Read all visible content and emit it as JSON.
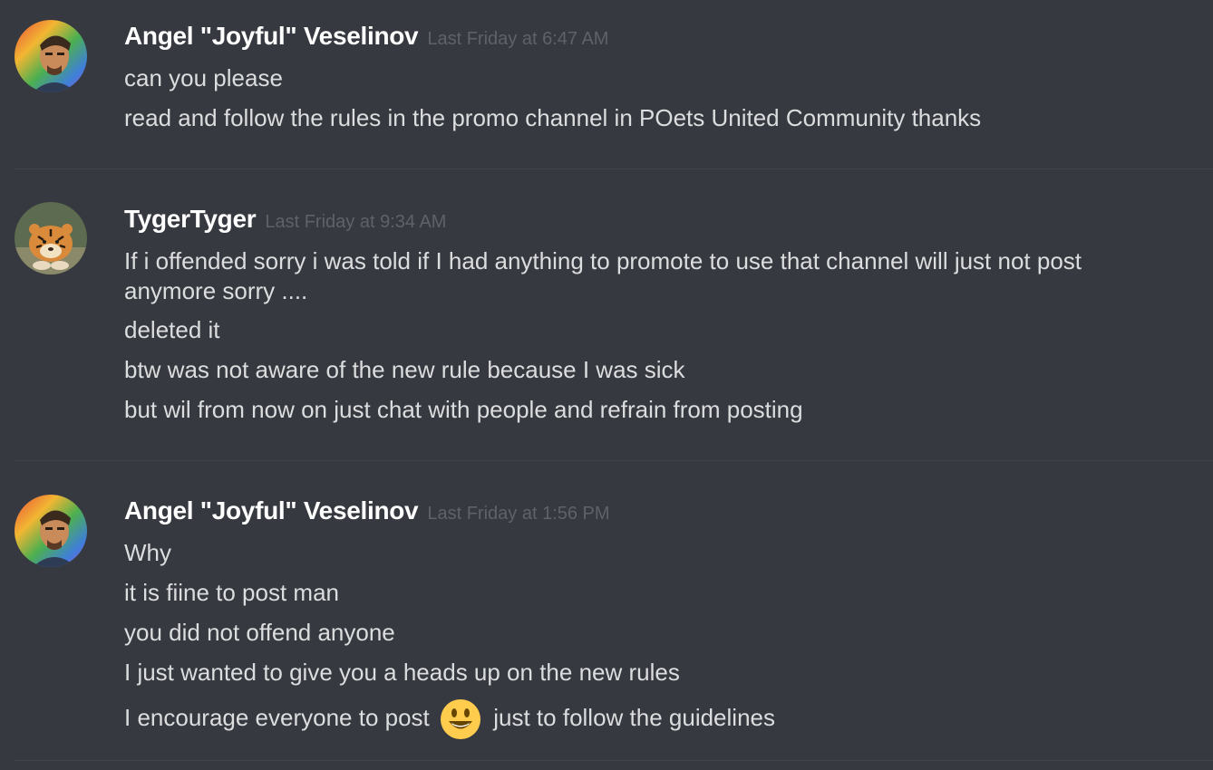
{
  "messages": [
    {
      "author": "Angel \"Joyful\" Veselinov",
      "timestamp": "Last Friday at 6:47 AM",
      "avatar": "rainbow-portrait-avatar",
      "lines": [
        "can you please",
        "read and follow the rules in the promo channel in POets United Community thanks"
      ]
    },
    {
      "author": "TygerTyger",
      "timestamp": "Last Friday at 9:34 AM",
      "avatar": "tiger-avatar",
      "lines": [
        "If i offended sorry i was told if I had anything to promote to use that channel will just not post anymore sorry ....",
        "deleted it",
        "btw was not aware of the new rule because I was sick",
        "but wil from now on just chat with people and refrain from posting"
      ]
    },
    {
      "author": "Angel \"Joyful\" Veselinov",
      "timestamp": "Last Friday at 1:56 PM",
      "avatar": "rainbow-portrait-avatar",
      "lines": [
        "Why",
        "it is fiine to post man",
        "you did not offend anyone",
        "I just wanted to give you a heads up on the new rules"
      ],
      "emoji_line": {
        "before": "I encourage everyone to post",
        "emoji": "smiley-emoji",
        "after": "just to follow the guidelines"
      }
    }
  ],
  "colors": {
    "background": "#36393f",
    "username": "#ffffff",
    "message_text": "#dcddde",
    "timestamp": "#5e6269",
    "divider": "#42454a"
  }
}
